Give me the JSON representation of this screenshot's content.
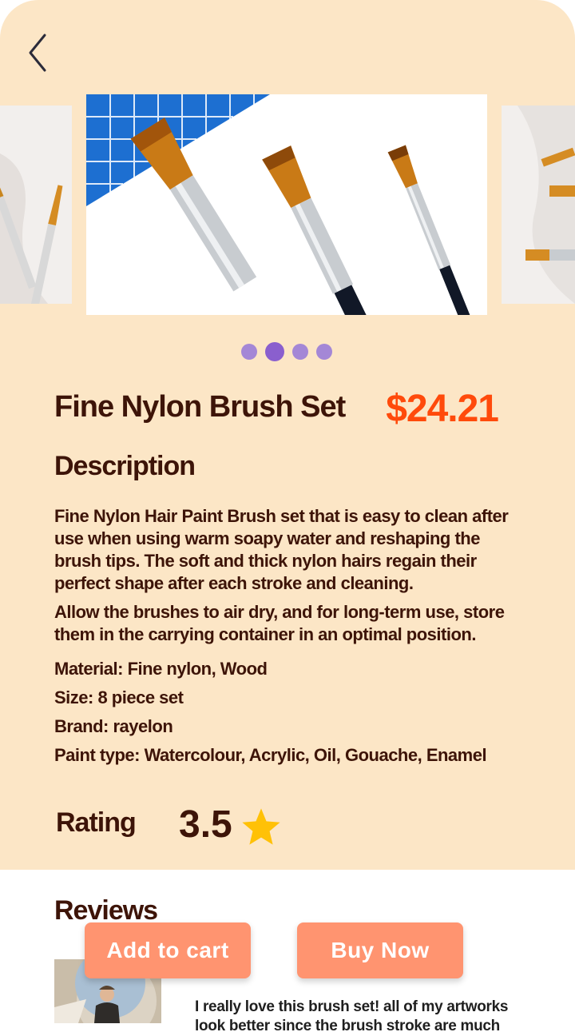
{
  "product": {
    "title": "Fine Nylon Brush Set",
    "price": "$24.21"
  },
  "carousel": {
    "slide_count": 4,
    "active_index": 1
  },
  "description": {
    "heading": "Description",
    "paragraphs": [
      "Fine Nylon Hair Paint Brush set that is easy to clean after use when using warm soapy water and reshaping the brush tips. The soft and thick nylon hairs regain their perfect shape after each stroke and cleaning.",
      "Allow the brushes to air dry, and for long-term use, store them in the carrying container in an optimal position."
    ],
    "specs": [
      "Material: Fine nylon, Wood",
      "Size: 8 piece set",
      "Brand: rayelon",
      "Paint type: Watercolour, Acrylic, Oil, Gouache, Enamel"
    ]
  },
  "rating": {
    "label": "Rating",
    "value": "3.5",
    "star_color": "#ffc107"
  },
  "reviews": {
    "heading": "Reviews",
    "first_review_text": "I really love this brush set! all of my artworks look better since the brush stroke are much"
  },
  "actions": {
    "add_to_cart": "Add to cart",
    "buy_now": "Buy Now"
  },
  "colors": {
    "background": "#fce6c6",
    "price": "#ff4a0b",
    "button": "#ff9470",
    "dot_active": "#8a5fce",
    "dot": "#a487d6",
    "text": "#3d1408"
  },
  "icons": [
    "back-chevron-icon",
    "star-icon"
  ]
}
